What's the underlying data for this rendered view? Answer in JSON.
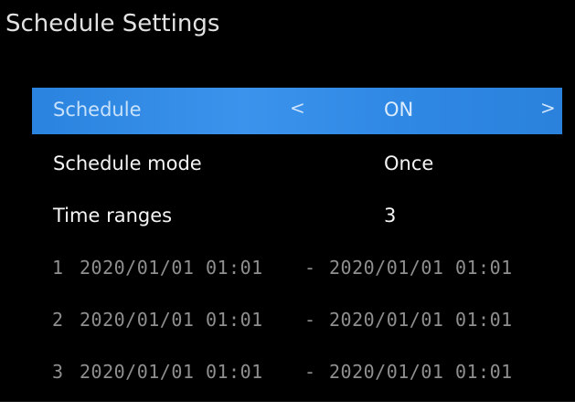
{
  "page": {
    "title": "Schedule Settings"
  },
  "schedule": {
    "label": "Schedule",
    "value": "ON",
    "prev_icon": "<",
    "next_icon": ">"
  },
  "schedule_mode": {
    "label": "Schedule mode",
    "value": "Once"
  },
  "time_ranges": {
    "label": "Time ranges",
    "value": "3"
  },
  "ranges": [
    {
      "index": "1",
      "start": "2020/01/01 01:01",
      "separator": "-",
      "end": "2020/01/01 01:01"
    },
    {
      "index": "2",
      "start": "2020/01/01 01:01",
      "separator": "-",
      "end": "2020/01/01 01:01"
    },
    {
      "index": "3",
      "start": "2020/01/01 01:01",
      "separator": "-",
      "end": "2020/01/01 01:01"
    }
  ],
  "colors": {
    "background": "#000000",
    "highlight": "#2f88e4",
    "text": "#f4f4f4",
    "dimmed_text": "#8f8f8f"
  }
}
